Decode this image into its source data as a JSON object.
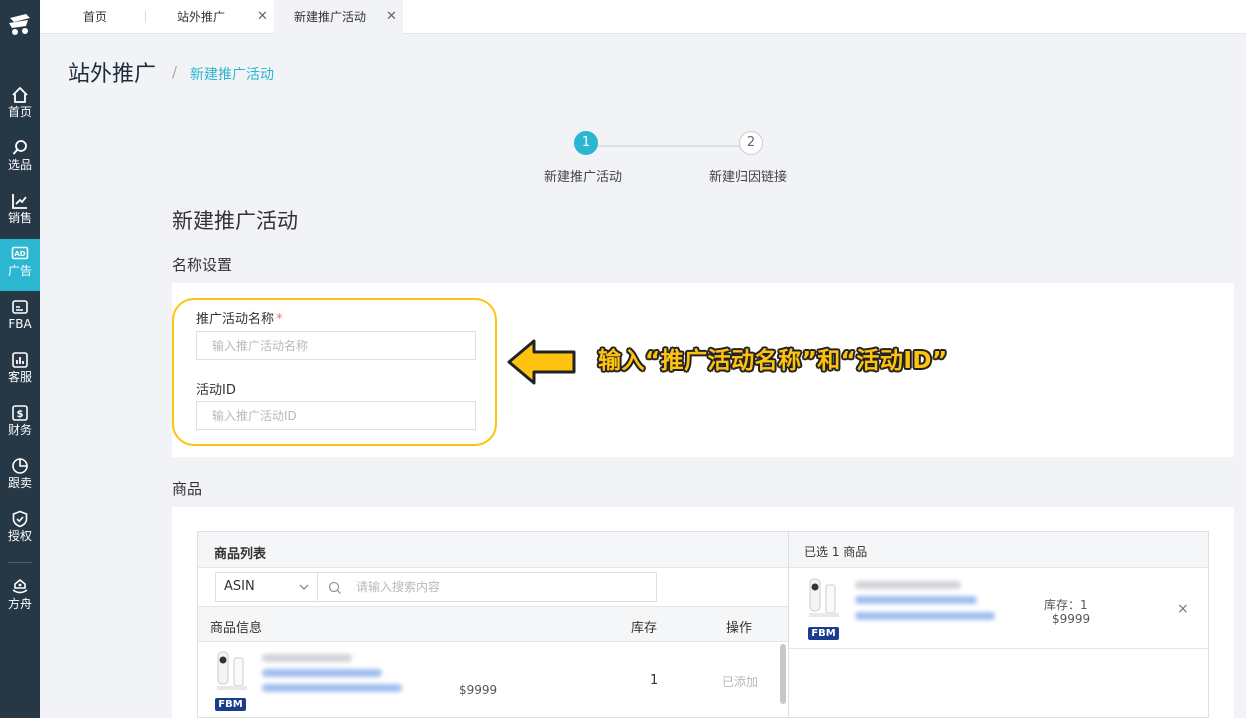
{
  "sidebar": {
    "items": [
      {
        "label": "首页",
        "icon": "home-icon"
      },
      {
        "label": "选品",
        "icon": "search-icon"
      },
      {
        "label": "销售",
        "icon": "chart-line-icon"
      },
      {
        "label": "广告",
        "icon": "ad-icon",
        "active": true
      },
      {
        "label": "FBA",
        "icon": "fba-box-icon"
      },
      {
        "label": "客服",
        "icon": "bar-chart-icon"
      },
      {
        "label": "财务",
        "icon": "dollar-icon"
      },
      {
        "label": "跟卖",
        "icon": "pie-chart-icon"
      },
      {
        "label": "授权",
        "icon": "shield-check-icon"
      },
      {
        "label": "方舟",
        "icon": "ark-icon"
      }
    ]
  },
  "tabs": [
    {
      "label": "首页",
      "closable": false
    },
    {
      "label": "站外推广",
      "closable": true
    },
    {
      "label": "新建推广活动",
      "closable": true,
      "active": true
    }
  ],
  "header": {
    "title": "站外推广",
    "separator": "/",
    "current": "新建推广活动"
  },
  "steps": [
    {
      "num": "1",
      "label": "新建推广活动",
      "active": true
    },
    {
      "num": "2",
      "label": "新建归因链接",
      "active": false
    }
  ],
  "form": {
    "section_title": "新建推广活动",
    "name_section": "名称设置",
    "campaign_name_label": "推广活动名称",
    "required_mark": "*",
    "campaign_name_placeholder": "输入推广活动名称",
    "campaign_id_label": "活动ID",
    "campaign_id_placeholder": "输入推广活动ID"
  },
  "annotation": {
    "text": "输入“推广活动名称”和“活动ID”"
  },
  "products": {
    "section_title": "商品",
    "list_title": "商品列表",
    "search_type": "ASIN",
    "search_placeholder": "请输入搜索内容",
    "columns": [
      "商品信息",
      "库存",
      "操作"
    ],
    "rows": [
      {
        "price": "$9999",
        "stock": "1",
        "action": "已添加",
        "badge": "FBM"
      }
    ],
    "selected_title": "已选 1 商品",
    "selected": [
      {
        "stock_text": "库存：1",
        "price": "$9999",
        "badge": "FBM",
        "remove": "×"
      }
    ]
  },
  "colors": {
    "accent": "#2bb6d2",
    "sidebar": "#263746",
    "highlight": "#ffc20e",
    "fbm": "#1b3d8f"
  }
}
